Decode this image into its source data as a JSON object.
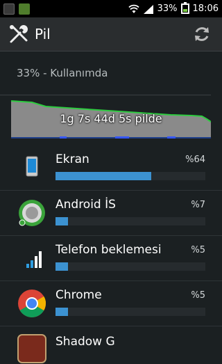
{
  "status_bar": {
    "battery_percent": "33%",
    "time": "18:06"
  },
  "action_bar": {
    "title": "Pil"
  },
  "summary": {
    "usage_text": "33% - Kullanımda",
    "graph_label": "1g 7s 44d 5s pilde"
  },
  "items": [
    {
      "name": "Ekran",
      "percent_text": "%64",
      "value": 0.64,
      "icon": "screen-icon"
    },
    {
      "name": "Android İS",
      "percent_text": "%7",
      "value": 0.07,
      "icon": "android-os-icon"
    },
    {
      "name": "Telefon beklemesi",
      "percent_text": "%5",
      "value": 0.05,
      "icon": "cell-standby-icon"
    },
    {
      "name": "Chrome",
      "percent_text": "%5",
      "value": 0.05,
      "icon": "chrome-icon"
    },
    {
      "name": "Shadow G",
      "icon": "app-icon"
    }
  ],
  "colors": {
    "bar_fill": "#3c92d1",
    "graph_line": "#2ecc40"
  }
}
